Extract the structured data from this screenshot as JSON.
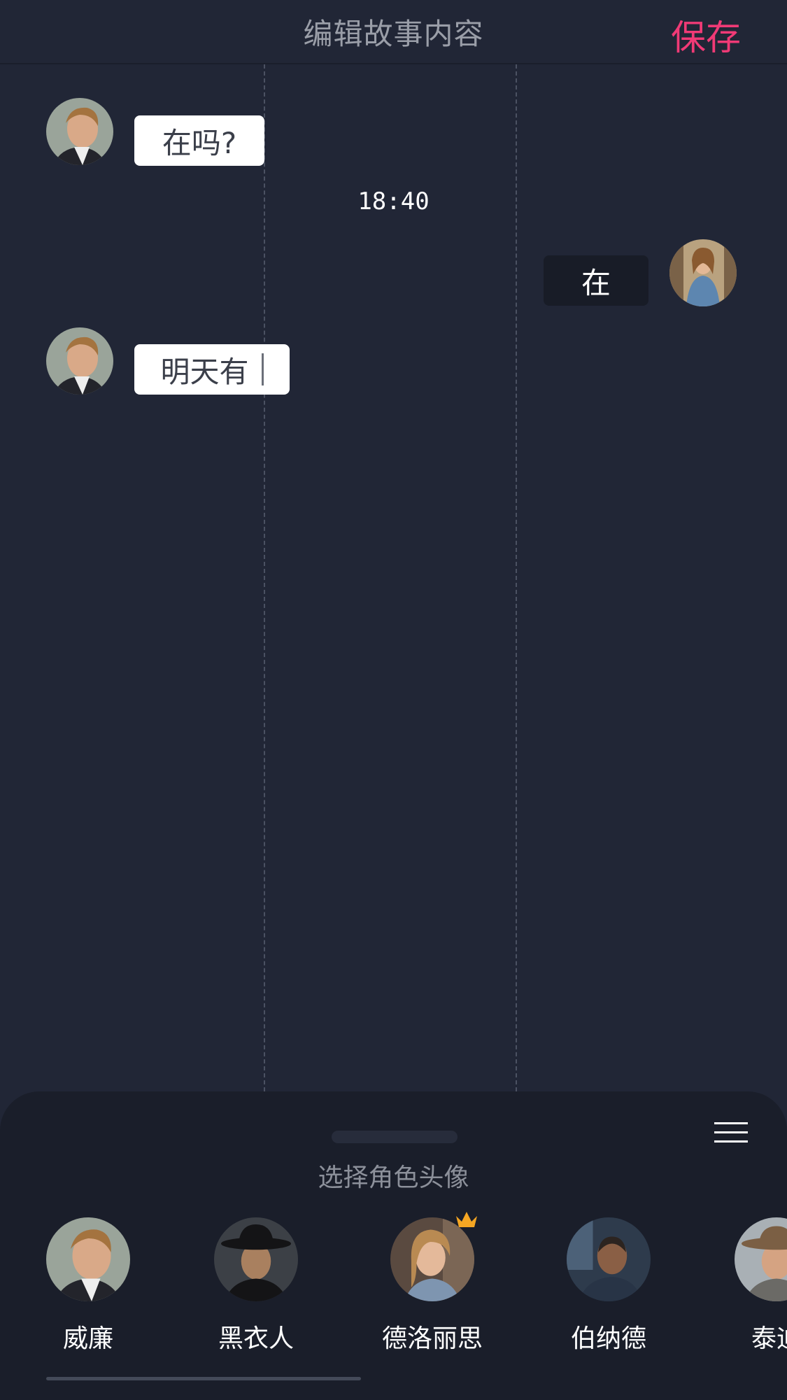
{
  "header": {
    "title": "编辑故事内容",
    "save_label": "保存"
  },
  "messages": [
    {
      "side": "left",
      "character": "威廉",
      "text": "在吗?"
    },
    {
      "timestamp": "18:40"
    },
    {
      "side": "right",
      "character": "德洛丽思",
      "text": "在"
    },
    {
      "side": "left",
      "character": "威廉",
      "text": "明天有"
    }
  ],
  "picker": {
    "title": "选择角色头像",
    "roles": [
      {
        "name": "威廉"
      },
      {
        "name": "黑衣人"
      },
      {
        "name": "德洛丽思",
        "badge": "crown-icon"
      },
      {
        "name": "伯纳德"
      },
      {
        "name": "泰迪"
      }
    ]
  },
  "colors": {
    "accent": "#f03a76",
    "background": "#212636",
    "sheet": "#1a1e2a",
    "crown": "#f5a623"
  }
}
